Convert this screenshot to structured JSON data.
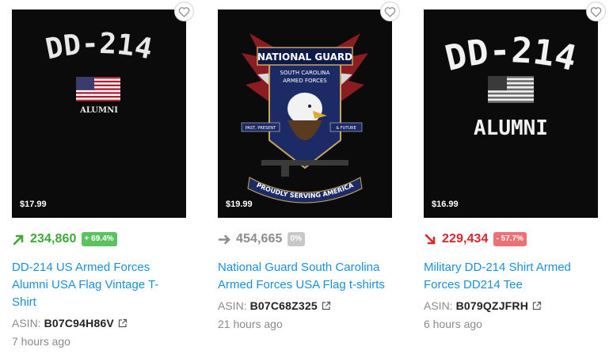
{
  "products": [
    {
      "price": "$17.99",
      "trend": "up",
      "trend_icon": "arrow-up-right-icon",
      "rank": "234,860",
      "change": "+ 69.4%",
      "title": "DD-214 US Armed Forces Alumni USA Flag Vintage T-Shirt",
      "asin_label": "ASIN:",
      "asin": "B07C94H86V",
      "time": "7 hours ago",
      "art": {
        "headline": "DD-214",
        "sub": "ALUMNI"
      }
    },
    {
      "price": "$19.99",
      "trend": "flat",
      "trend_icon": "arrow-right-icon",
      "rank": "454,665",
      "change": "0%",
      "title": "National Guard South Carolina Armed Forces USA Flag t-shirts",
      "asin_label": "ASIN:",
      "asin": "B07C68Z325",
      "time": "21 hours ago",
      "art": {
        "headline": "NATIONAL GUARD",
        "line1": "SOUTH CAROLINA",
        "line2": "ARMED FORCES",
        "left_ribbon": "PAST, PRESENT",
        "right_ribbon": "& FUTURE",
        "banner": "PROUDLY SERVING AMERICA"
      }
    },
    {
      "price": "$16.99",
      "trend": "down",
      "trend_icon": "arrow-down-right-icon",
      "rank": "229,434",
      "change": "- 57.7%",
      "title": "Military DD-214 Shirt Armed Forces DD214 Tee",
      "asin_label": "ASIN:",
      "asin": "B079QZJFRH",
      "time": "6 hours ago",
      "art": {
        "headline": "DD-214",
        "sub": "ALUMNI"
      }
    }
  ],
  "colors": {
    "link": "#1a8fdc",
    "up": "#3aaa35",
    "flat": "#8c8c8c",
    "down": "#d9262b"
  }
}
